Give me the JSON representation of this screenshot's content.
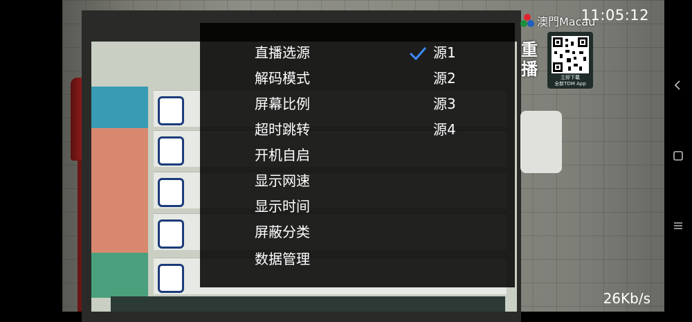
{
  "brand": {
    "name": "澳門Macau"
  },
  "clock": {
    "time": "11:05:12"
  },
  "side": {
    "replay_label": "重播",
    "qr_caption_line1": "立即下載",
    "qr_caption_line2": "全新TDM App"
  },
  "status": {
    "net_speed": "26Kb/s"
  },
  "menu": {
    "items": [
      {
        "label": "直播选源"
      },
      {
        "label": "解码模式"
      },
      {
        "label": "屏幕比例"
      },
      {
        "label": "超时跳转"
      },
      {
        "label": "开机自启"
      },
      {
        "label": "显示网速"
      },
      {
        "label": "显示时间"
      },
      {
        "label": "屏蔽分类"
      },
      {
        "label": "数据管理"
      }
    ],
    "options": [
      {
        "label": "源1",
        "selected": true
      },
      {
        "label": "源2",
        "selected": false
      },
      {
        "label": "源3",
        "selected": false
      },
      {
        "label": "源4",
        "selected": false
      }
    ],
    "check_color": "#3d8bff"
  },
  "navigation": {
    "buttons": [
      {
        "icon": "back-icon"
      },
      {
        "icon": "home-icon"
      },
      {
        "icon": "menu-icon"
      }
    ]
  }
}
